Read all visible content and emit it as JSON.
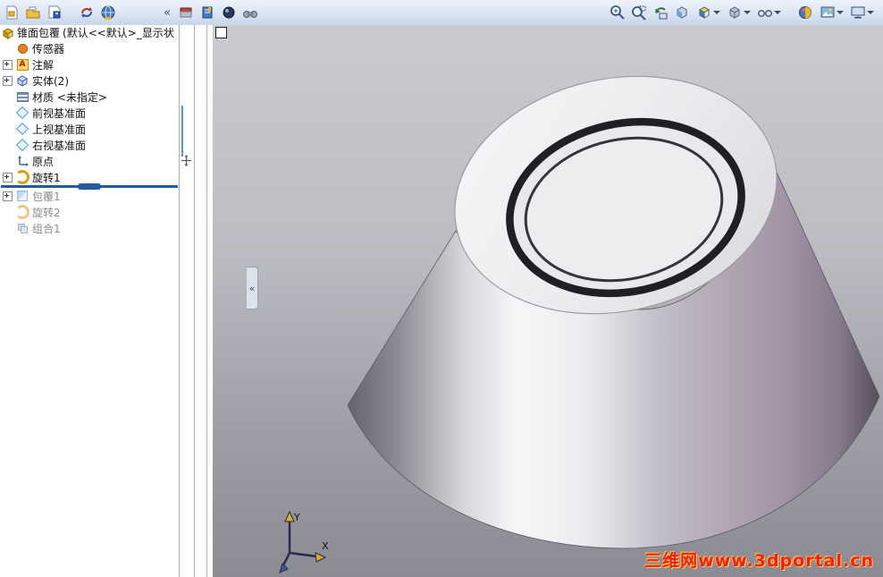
{
  "toolbar": {
    "collapse_glyph": "«",
    "left_buttons": [
      {
        "name": "new-document"
      },
      {
        "name": "open-document"
      },
      {
        "name": "save-document"
      },
      {
        "name": "rebuild"
      },
      {
        "name": "options"
      }
    ],
    "panel_buttons": [
      {
        "name": "toolbox"
      },
      {
        "name": "design-library"
      },
      {
        "name": "file-explorer"
      },
      {
        "name": "search"
      }
    ],
    "right_buttons": [
      {
        "name": "zoom-to-fit"
      },
      {
        "name": "zoom-to-area"
      },
      {
        "name": "previous-view"
      },
      {
        "name": "section-view"
      },
      {
        "name": "view-orientation",
        "caret": true
      },
      {
        "name": "display-style",
        "caret": true
      },
      {
        "name": "hide-show-items",
        "caret": true
      },
      {
        "name": "edit-appearance"
      },
      {
        "name": "apply-scene",
        "caret": true
      },
      {
        "name": "view-settings",
        "caret": true
      }
    ]
  },
  "tree": {
    "root_name": "锥面包覆",
    "root_suffix": "(默认<<默认>_显示状",
    "items": [
      {
        "label": "传感器",
        "icon": "sensor"
      },
      {
        "label": "注解",
        "icon": "annotations"
      },
      {
        "label": "实体(2)",
        "icon": "solid-bodies"
      },
      {
        "label": "材质 <未指定>",
        "icon": "material"
      },
      {
        "label": "前视基准面",
        "icon": "plane"
      },
      {
        "label": "上视基准面",
        "icon": "plane"
      },
      {
        "label": "右视基准面",
        "icon": "plane"
      },
      {
        "label": "原点",
        "icon": "origin"
      },
      {
        "label": "旋转1",
        "icon": "revolve"
      },
      {
        "label": "包覆1",
        "icon": "wrap",
        "suppressed": true
      },
      {
        "label": "旋转2",
        "icon": "revolve",
        "suppressed": true
      },
      {
        "label": "组合1",
        "icon": "combine",
        "suppressed": true
      }
    ],
    "rollback_position": "after 旋转1"
  },
  "viewport": {
    "watermark": "三维网www.3dportal.cn",
    "triad": {
      "x": "X",
      "y": "Y"
    },
    "colors": {
      "bg_top": "#cacad0",
      "bg_bottom": "#8b8b93",
      "rollback_blue": "#2458a8",
      "watermark_red": "#ff1a1a"
    }
  }
}
